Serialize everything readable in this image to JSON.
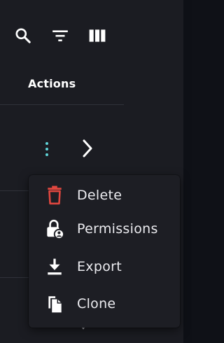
{
  "toolbar": {
    "search_icon": "search-icon",
    "filter_icon": "filter-icon",
    "columns_icon": "columns-icon"
  },
  "table": {
    "actions_header": "Actions"
  },
  "row": {
    "kebab_icon": "kebab-icon",
    "chevron_icon": "chevron-right-icon"
  },
  "menu": {
    "items": [
      {
        "label": "Delete",
        "icon": "trash-icon",
        "color": "#e0473f"
      },
      {
        "label": "Permissions",
        "icon": "lock-user-icon",
        "color": "#ffffff"
      },
      {
        "label": "Export",
        "icon": "download-icon",
        "color": "#ffffff"
      },
      {
        "label": "Clone",
        "icon": "copy-icon",
        "color": "#ffffff"
      }
    ]
  },
  "colors": {
    "accent": "#5fd4d8",
    "danger": "#e0473f",
    "panel": "#1b1c22",
    "menu": "#1d1e24"
  }
}
